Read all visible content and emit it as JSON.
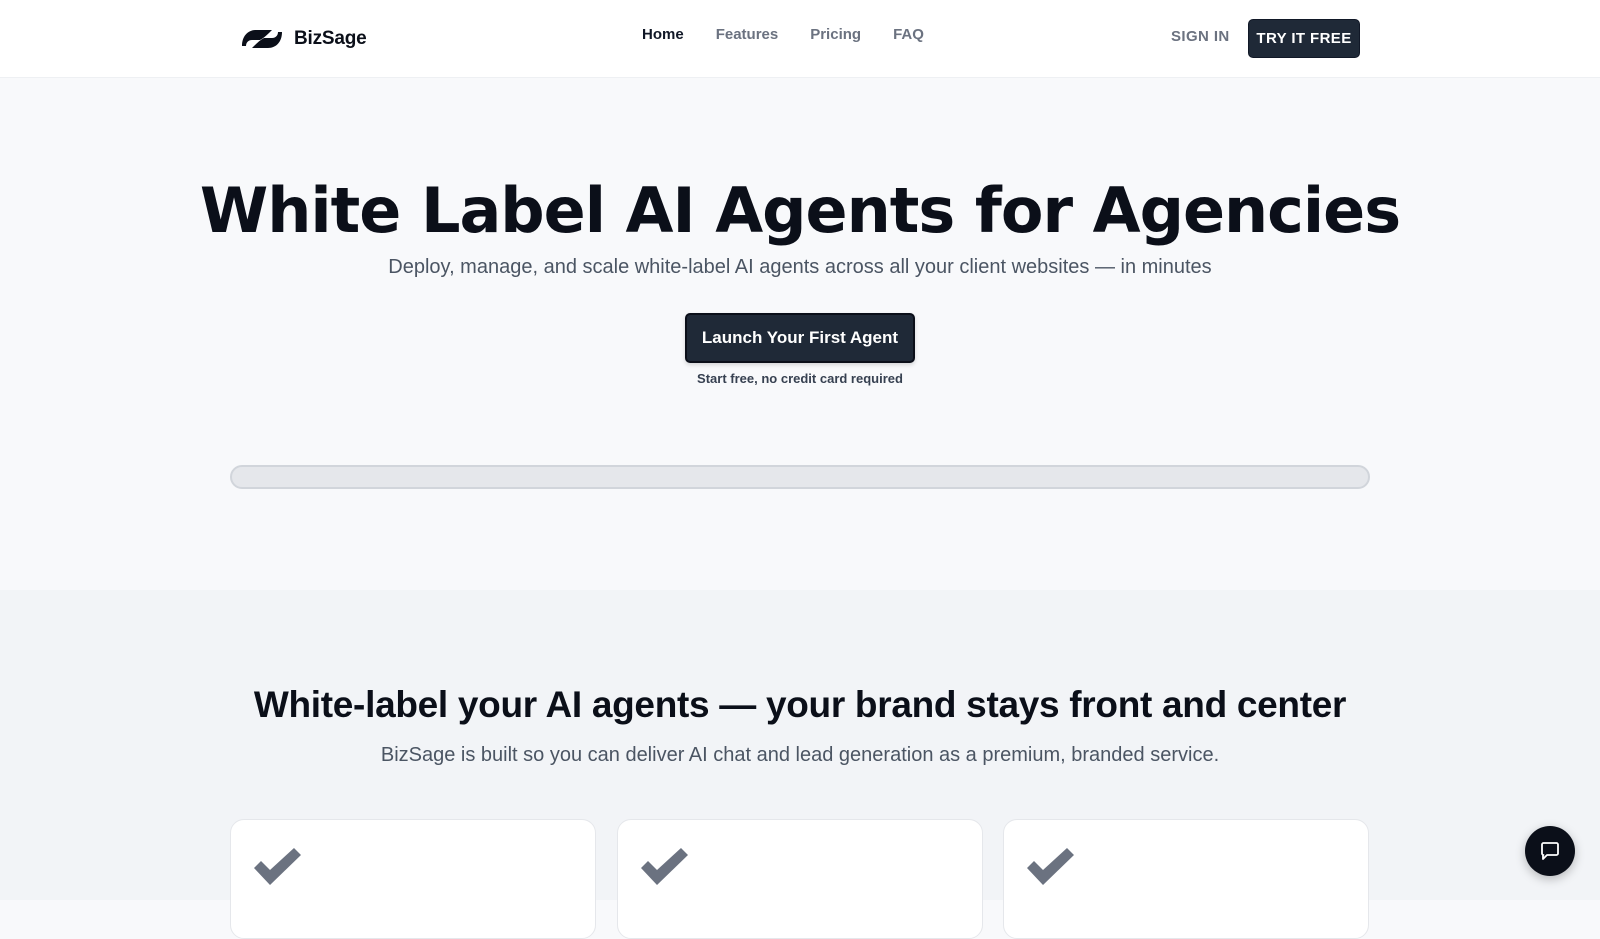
{
  "nav": {
    "brand": "BizSage",
    "links": [
      {
        "label": "Home",
        "active": true
      },
      {
        "label": "Features",
        "active": false
      },
      {
        "label": "Pricing",
        "active": false
      },
      {
        "label": "FAQ",
        "active": false
      }
    ],
    "sign_in": "SIGN IN",
    "try_free": "TRY IT FREE"
  },
  "hero": {
    "title": "White Label AI Agents for Agencies",
    "subtitle": "Deploy, manage, and scale white-label AI agents across all your client websites — in minutes",
    "cta_label": "Launch Your First Agent",
    "cta_note": "Start free, no credit card required"
  },
  "section2": {
    "title": "White-label your AI agents — your brand stays front and center",
    "subtitle": "BizSage is built so you can deliver AI chat and lead generation as a premium, branded service.",
    "cards": [
      {
        "icon": "check-icon"
      },
      {
        "icon": "check-icon"
      },
      {
        "icon": "check-icon"
      }
    ]
  },
  "chat_widget": {
    "icon": "chat-bubble-icon"
  },
  "colors": {
    "primary_dark": "#1f2937",
    "text_dark": "#0b0f19",
    "text_muted": "#6b7280",
    "check_gray": "#6b7280",
    "hero_bg": "#f8f9fb",
    "section_bg": "#f2f4f7"
  }
}
